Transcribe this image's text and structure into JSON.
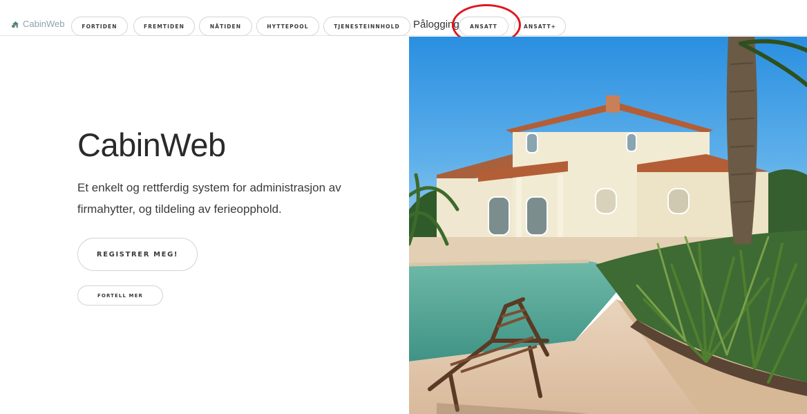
{
  "brand": {
    "name": "CabinWeb"
  },
  "nav": {
    "items": [
      {
        "label": "FORTIDEN"
      },
      {
        "label": "FREMTIDEN"
      },
      {
        "label": "NÅTIDEN"
      },
      {
        "label": "HYTTEPOOL"
      },
      {
        "label": "TJENESTEINNHOLD"
      }
    ],
    "login_label": "Pålogging:",
    "login_items": [
      {
        "label": "ANSATT"
      },
      {
        "label": "ANSATT+"
      }
    ]
  },
  "hero": {
    "title": "CabinWeb",
    "subtitle": "Et enkelt og rettferdig system for administrasjon av firmahytter, og tildeling av ferieopphold.",
    "primary_cta": "REGISTRER MEG!",
    "secondary_cta": "FORTELL MER"
  },
  "colors": {
    "brand_text": "#8ca3ad",
    "highlight_ring": "#e0161d",
    "pill_border": "#d3d3d3",
    "text_dark": "#2a2a2a"
  },
  "icons": {
    "brand_logo": "cabinweb-logo-icon"
  }
}
